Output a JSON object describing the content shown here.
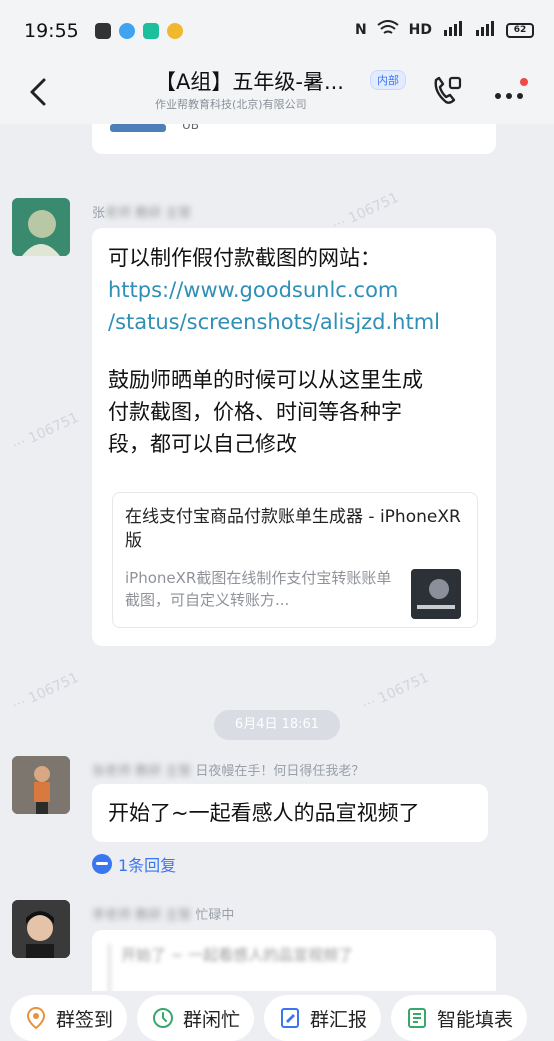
{
  "status_bar": {
    "time": "19:55",
    "signal_text": "N  ",
    "hd_text": "HD",
    "battery_text": "62"
  },
  "header": {
    "title": "【A组】五年级-暑...",
    "badge": "内部",
    "subtitle": "作业帮教育科技(北京)有限公司"
  },
  "messages": [
    {
      "sender": "张",
      "lines": [
        "可以制作假付款截图的网站："
      ],
      "link_lines": [
        "https://www.goodsunlc.com",
        "/status/screenshots/alisjzd.html"
      ],
      "body_lines": [
        "鼓励师晒单的时候可以从这里生成",
        "付款截图，价格、时间等各种字",
        "段，都可以自己修改"
      ],
      "card": {
        "title": "在线支付宝商品付款账单生成器 - iPhoneXR版",
        "desc": "iPhoneXR截图在线制作支付宝转账账单截图，可自定义转账方..."
      }
    }
  ],
  "timestamp": "6月4日 18:61",
  "message2": {
    "sender_suffix": "日夜幔在手！何日得任我老？",
    "text": "开始了~一起看感人的品宣视频了",
    "reply": "1条回复"
  },
  "message3": {
    "sender_suffix": "忙碌中"
  },
  "toolbar": {
    "items": [
      {
        "label": "群签到",
        "icon": "location-pin-icon"
      },
      {
        "label": "群闲忙",
        "icon": "clock-icon"
      },
      {
        "label": "群汇报",
        "icon": "report-icon"
      },
      {
        "label": "智能填表",
        "icon": "form-icon"
      }
    ]
  },
  "colors": {
    "accent": "#3a76f0",
    "link": "#2f8fb5",
    "background": "#eceef2",
    "bubble": "#ffffff"
  }
}
